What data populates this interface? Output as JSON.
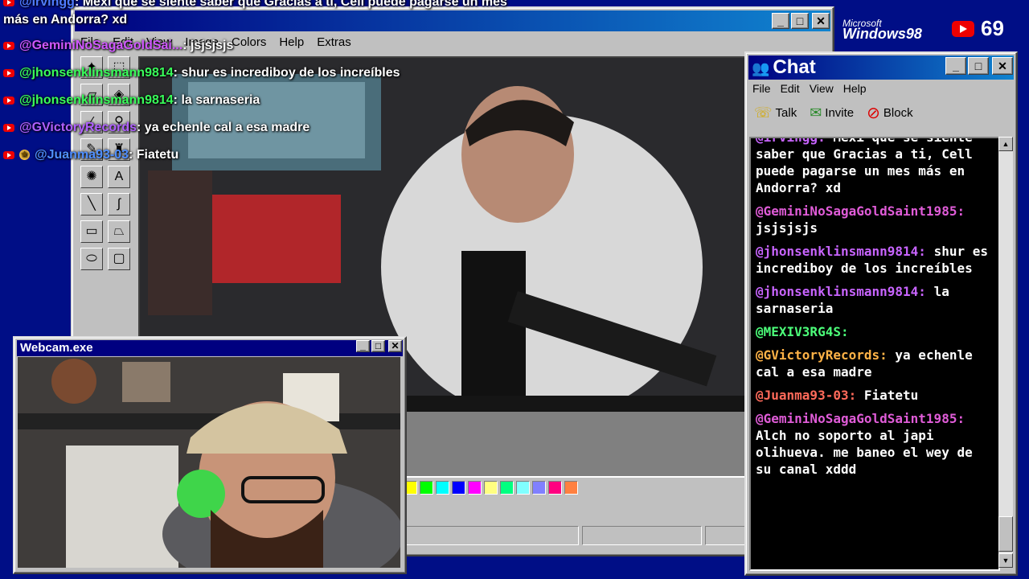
{
  "paint": {
    "menu": [
      "File",
      "Edit",
      "View",
      "Image",
      "Colors",
      "Help",
      "Extras"
    ],
    "palette": [
      "#ffff00",
      "#00ff00",
      "#00ffff",
      "#0000ff",
      "#ff00ff",
      "#ffff80",
      "#00ff80",
      "#80ffff",
      "#8080ff",
      "#ff0080",
      "#ff8040"
    ]
  },
  "overlay": [
    {
      "user": "@irvingg",
      "text": ": Mexi que se siente saber que Gracias a ti, Cell puede pagarse un mes",
      "color": "#4f7cff",
      "badge": "yt"
    },
    {
      "user": "",
      "text": "más en Andorra? xd",
      "color": "#ffffff",
      "badge": ""
    },
    {
      "user": "@GeminiNoSagaGoldSai...",
      "text": ": jsjsjsjs",
      "color": "#d058ff",
      "badge": "yt"
    },
    {
      "user": "@jhonsenklinsmann9814",
      "text": ": shur es incrediboy de los increíbles",
      "color": "#39ff5a",
      "badge": "yt"
    },
    {
      "user": "@jhonsenklinsmann9814",
      "text": ": la sarnaseria",
      "color": "#39ff5a",
      "badge": "yt"
    },
    {
      "user": "@GVictoryRecords",
      "text": ": ya echenle cal a esa madre",
      "color": "#b060ff",
      "badge": "yt"
    },
    {
      "user": "@Juanma93-03",
      "text": ": Fiatetu",
      "color": "#4f8fff",
      "badge": "yt-star"
    }
  ],
  "webcam": {
    "title": "Webcam.exe"
  },
  "chat": {
    "title": "Chat",
    "menu": [
      "File",
      "Edit",
      "View",
      "Help"
    ],
    "toolbar": {
      "talk": "Talk",
      "invite": "Invite",
      "block": "Block"
    },
    "messages": [
      {
        "user": "@irvingg:",
        "text": "Mexi que se siente saber que Gracias a ti, Cell puede pagarse un mes más en Andorra? xd",
        "color": "#c864ff"
      },
      {
        "user": "@GeminiNoSagaGoldSaint1985:",
        "text": "jsjsjsjs",
        "color": "#e05cd8"
      },
      {
        "user": "@jhonsenklinsmann9814:",
        "text": "shur es incrediboy de los increíbles",
        "color": "#c864ff"
      },
      {
        "user": "@jhonsenklinsmann9814:",
        "text": "la sarnaseria",
        "color": "#c864ff"
      },
      {
        "user": "@MEXIV3RG4S:",
        "text": "",
        "color": "#4cff7a"
      },
      {
        "user": "@GVictoryRecords:",
        "text": "ya echenle cal a esa madre",
        "color": "#ffb347"
      },
      {
        "user": "@Juanma93-03:",
        "text": "Fiatetu",
        "color": "#ff6a5a"
      },
      {
        "user": "@GeminiNoSagaGoldSaint1985:",
        "text": "Alch no soporto al japi olihueva. me baneo el wey de su canal xddd",
        "color": "#e05cd8"
      }
    ]
  },
  "branding": {
    "ms": "Microsoft",
    "os": "Windows98",
    "viewers": "69"
  }
}
